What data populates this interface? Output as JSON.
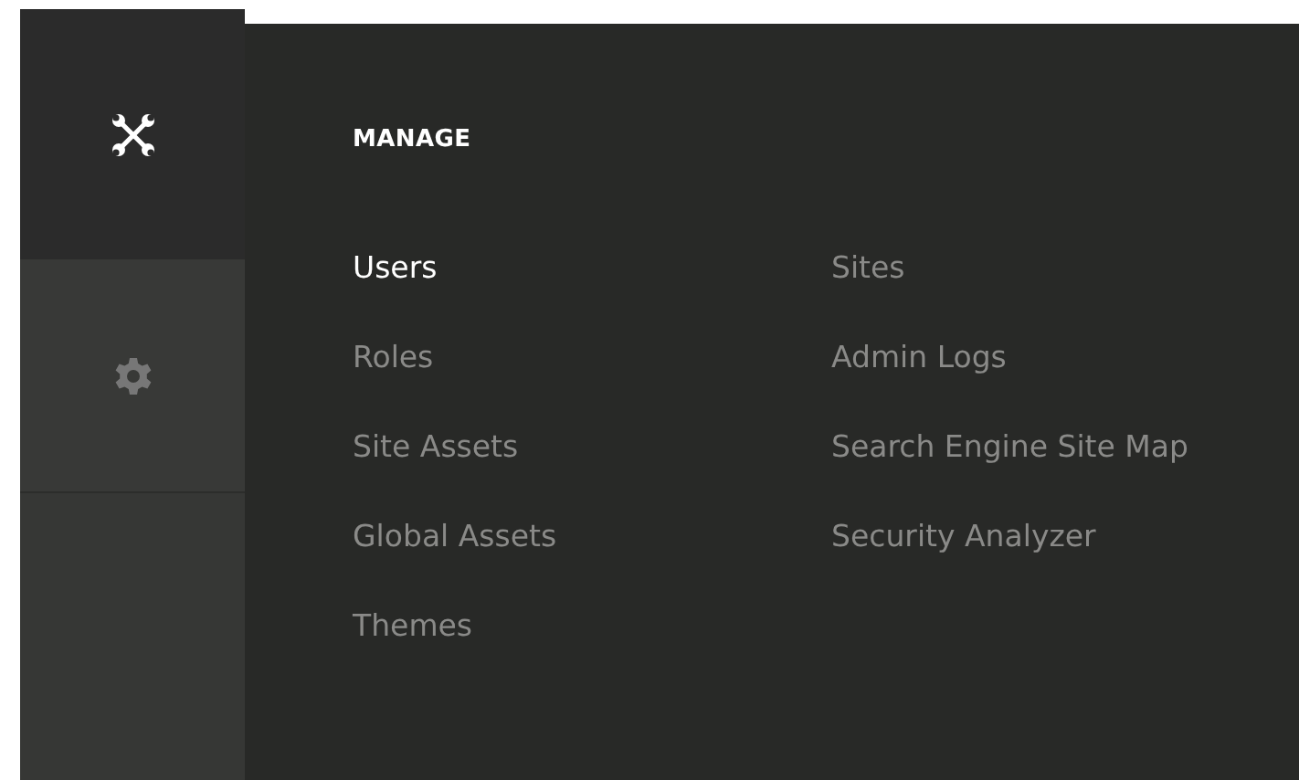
{
  "sidebar": {
    "items": [
      {
        "kind": "tools",
        "selected": true
      },
      {
        "kind": "settings",
        "selected": false
      }
    ]
  },
  "panel": {
    "heading": "MANAGE",
    "columns": [
      [
        {
          "label": "Users",
          "selected": true
        },
        {
          "label": "Roles",
          "selected": false
        },
        {
          "label": "Site Assets",
          "selected": false
        },
        {
          "label": "Global Assets",
          "selected": false
        },
        {
          "label": "Themes",
          "selected": false
        }
      ],
      [
        {
          "label": "Sites",
          "selected": false
        },
        {
          "label": "Admin Logs",
          "selected": false
        },
        {
          "label": "Search Engine Site Map",
          "selected": false
        },
        {
          "label": "Security Analyzer",
          "selected": false
        }
      ]
    ]
  }
}
